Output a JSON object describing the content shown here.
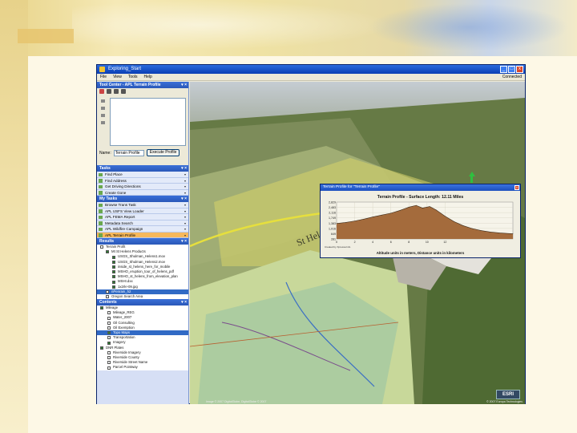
{
  "window": {
    "title": "Exploring_Start",
    "menu": [
      "File",
      "View",
      "Tools",
      "Help"
    ],
    "status": "Connected",
    "buttons": [
      "_",
      "□",
      "x"
    ]
  },
  "tool_center": {
    "header": "Tool Center - APL Terrain Profile",
    "header_buttons": "▾ ×",
    "name_label": "Name:",
    "name_value": "Terrain Profile",
    "button": "Execute Profile"
  },
  "tasks_panel": {
    "header": "Tasks",
    "items": [
      "Find Place",
      "Find Address",
      "Get Driving Directions",
      "Create Gone"
    ]
  },
  "my_tasks_panel": {
    "header": "My Tasks",
    "items": [
      "Browse Trans Task",
      "APL USFS View Loader",
      "APL FEMA Report",
      "Metadata Search",
      "APL Wildfire Campaign",
      "APL Terrain Profile"
    ],
    "active_index": 5
  },
  "results_panel": {
    "header": "Results",
    "items": [
      "Terrain Profit",
      "Mt St Helens Products",
      "USGS_Shulman_Helens1.mov",
      "USGS_Shulman_Helens2.mov",
      "inside_st_helens_here_for_mobile",
      "MSHO_eruption_tour_of_helens_pdf",
      "MSHO_st_helens_from_elevation_plan",
      "MSHI.dxx",
      "1x2rk+09.jpg",
      "nPenrain_h2",
      "Oregon Search Area"
    ],
    "selected_index": 9
  },
  "contents_panel": {
    "header": "Contents",
    "items": [
      "Mileage",
      "Mileage_REG",
      "Water_2007",
      "Oil Consulting",
      "Oil Exemption",
      "Topo Maps",
      "Transportation",
      "Imagery",
      "DNR Plates",
      "Riverside Imagery",
      "Riverside County",
      "Riverside Street Name",
      "Parcel Pointway"
    ],
    "selected_index": 5
  },
  "profile_dialog": {
    "title": "Terrain Profile for \"Terrain Profile\"",
    "close": "x",
    "heading": "Terrain Profile - Surface Length: 12.11 Miles",
    "footer": "Altitude units in meters, Distance units in kilometers",
    "caption": "Created by Xpressa Info"
  },
  "map": {
    "label": "St Helens",
    "logo": "ESRI",
    "copyright_left": "Image © 2007 DigitalGlobe, DigitalGlobe © 2007",
    "copyright_right": "© 2007 Europa Technologies"
  },
  "chart_data": {
    "type": "area",
    "title": "Terrain Profile - Surface Length: 12.11 Miles",
    "xlabel": "Distance units in kilometers",
    "ylabel": "Altitude units in meters",
    "yticks": [
      "2,829",
      "2,483",
      "2,116",
      "1,749",
      "1,383",
      "1,016",
      "649",
      "281"
    ],
    "xticks": [
      "0",
      "2",
      "4",
      "6",
      "8",
      "10",
      "12"
    ],
    "xlim": [
      0,
      19.5
    ],
    "ylim": [
      281,
      2829
    ],
    "x": [
      0,
      1,
      2,
      3,
      4,
      5,
      6,
      7,
      8,
      8.8,
      9.5,
      10.3,
      11,
      12,
      13,
      14,
      15,
      16,
      17,
      18,
      19.5
    ],
    "y": [
      1350,
      1420,
      1520,
      1650,
      1800,
      1930,
      2060,
      2250,
      2480,
      2600,
      2420,
      2520,
      2290,
      1850,
      1480,
      1200,
      1000,
      860,
      760,
      700,
      640
    ],
    "fill": "#a46b3c",
    "grid": true
  }
}
